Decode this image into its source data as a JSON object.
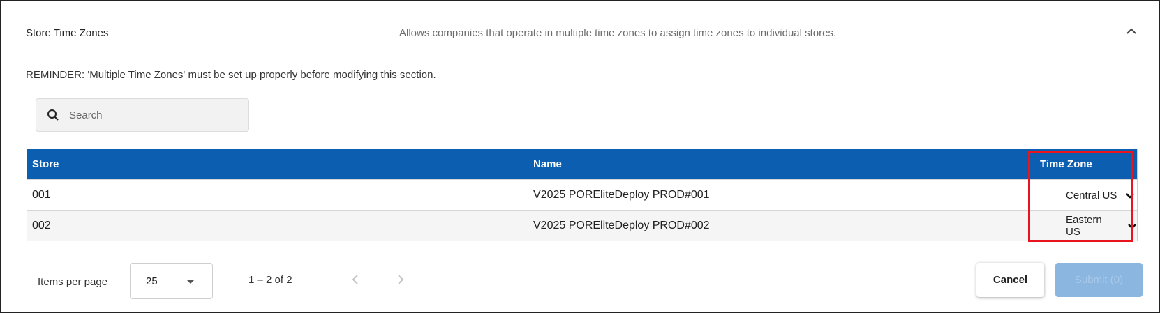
{
  "section": {
    "title": "Store Time Zones",
    "description": "Allows companies that operate in multiple time zones to assign time zones to individual stores.",
    "collapse_icon": "chevron-up-icon"
  },
  "reminder": "REMINDER: 'Multiple Time Zones' must be set up properly before modifying this section.",
  "search": {
    "placeholder": "Search",
    "value": "",
    "icon": "search-icon"
  },
  "table": {
    "headers": {
      "store": "Store",
      "name": "Name",
      "time_zone": "Time Zone"
    },
    "header_color": "#0b5eb0",
    "rows": [
      {
        "store": "001",
        "name": "V2025 POREliteDeploy PROD#001",
        "time_zone": "Central US"
      },
      {
        "store": "002",
        "name": "V2025 POREliteDeploy PROD#002",
        "time_zone": "Eastern US"
      }
    ],
    "highlight_color": "#e8141e"
  },
  "pagination": {
    "items_per_page_label": "Items per page",
    "items_per_page_value": "25",
    "range_text": "1 – 2 of 2"
  },
  "actions": {
    "cancel_label": "Cancel",
    "submit_label": "Submit (0)",
    "submit_color": "#8ab6e0"
  }
}
